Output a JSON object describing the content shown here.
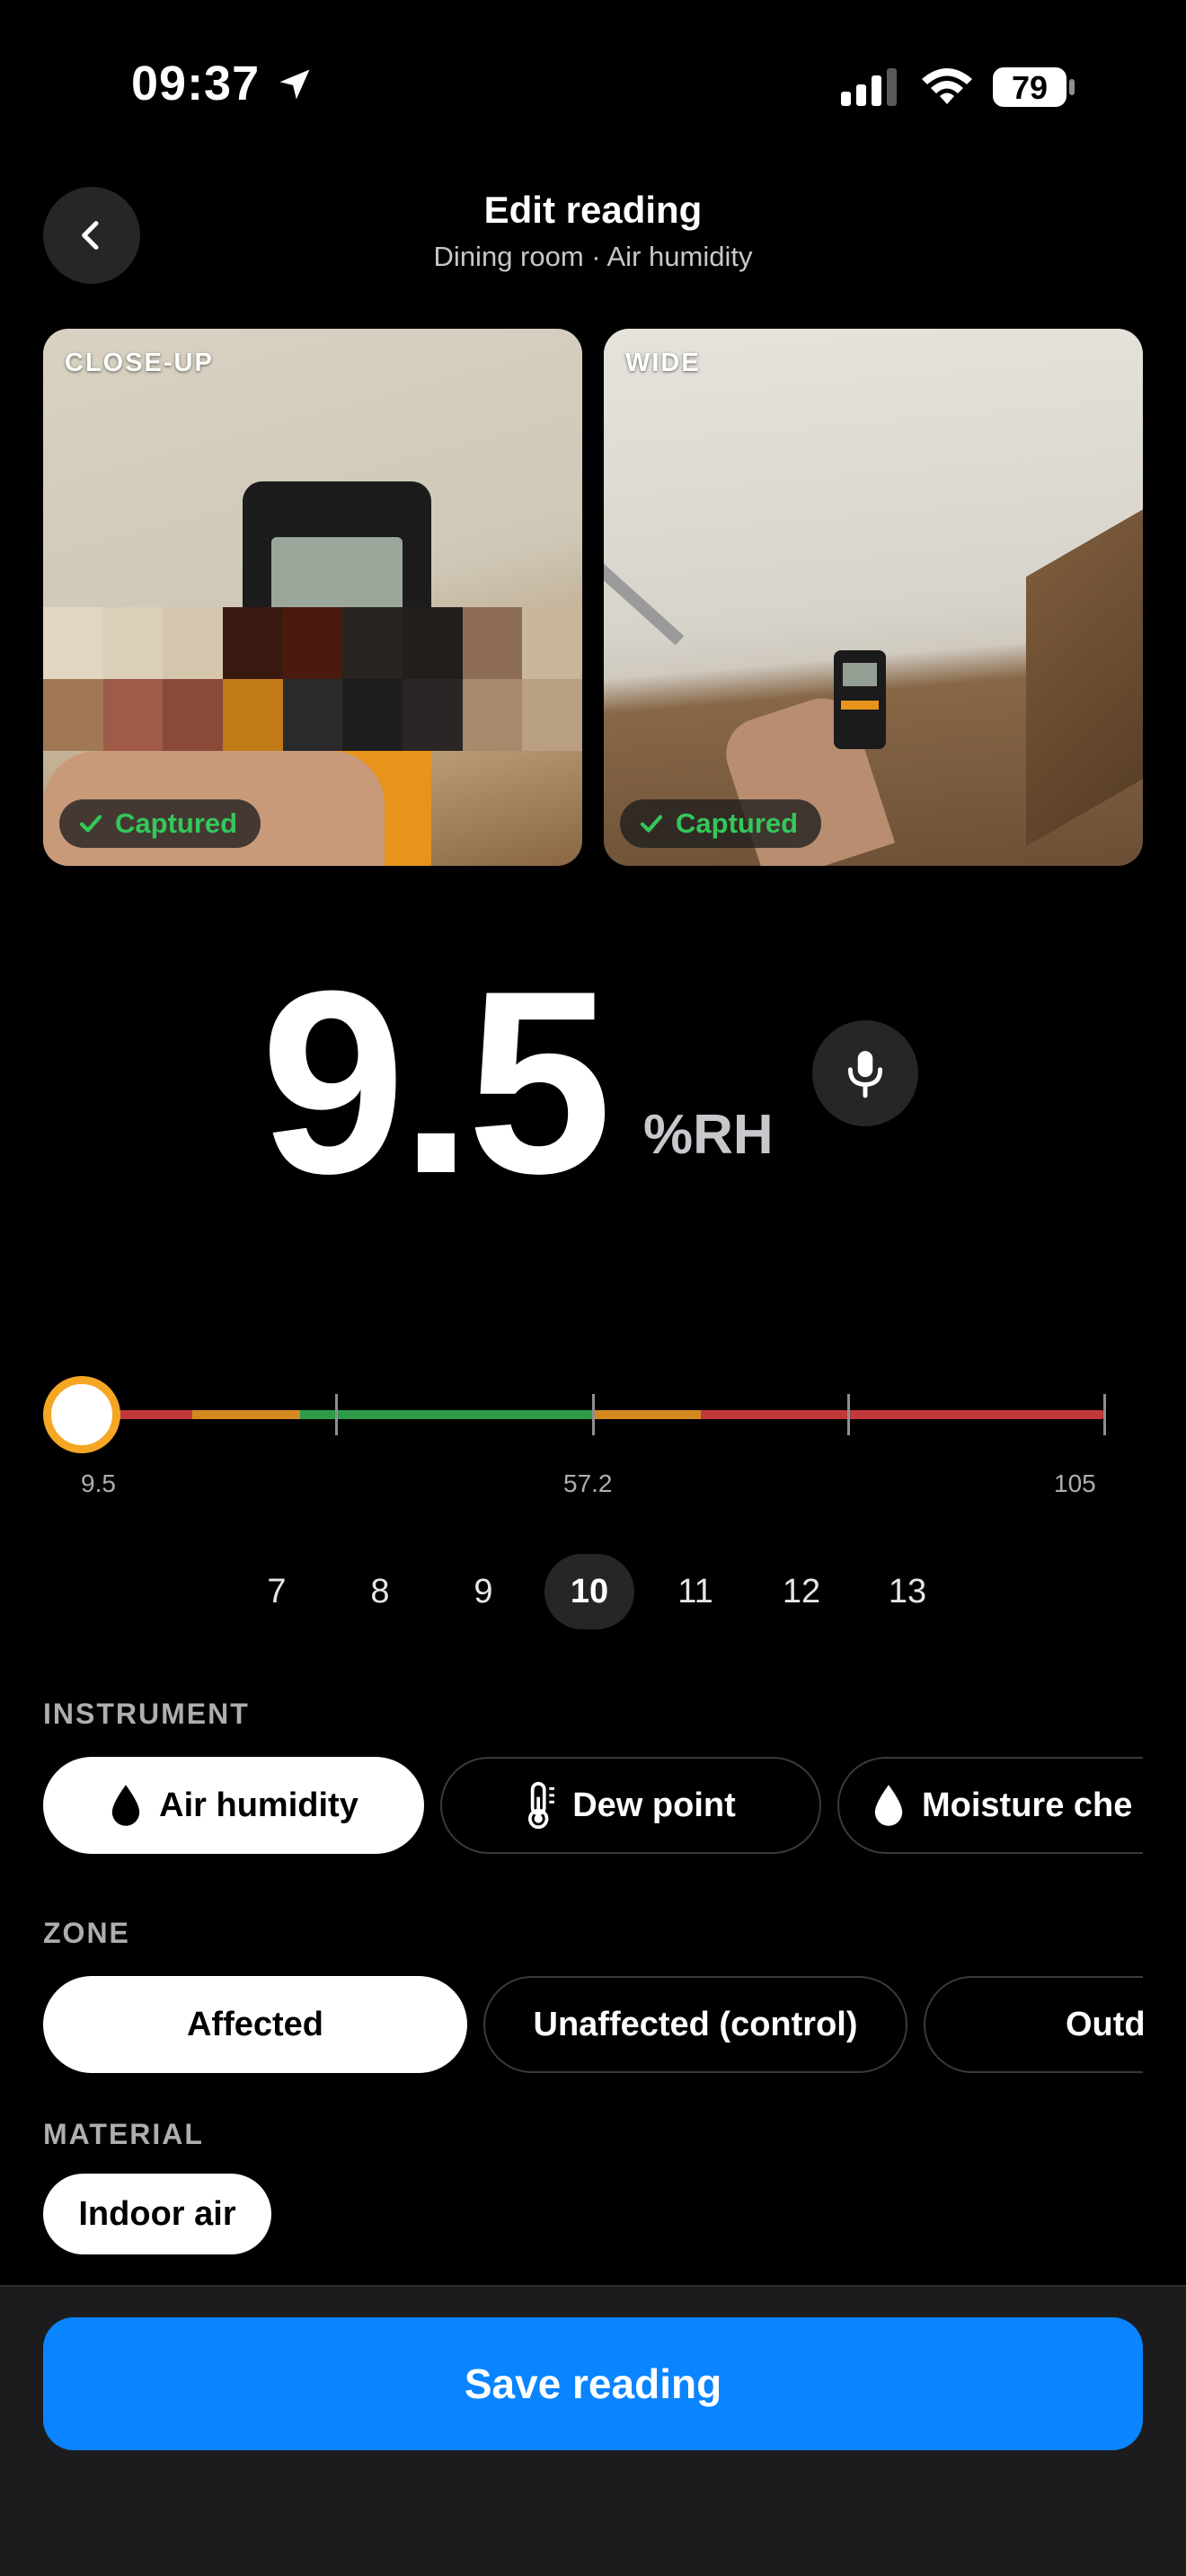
{
  "status_bar": {
    "time": "09:37",
    "battery": "79"
  },
  "header": {
    "title": "Edit reading",
    "subtitle": "Dining room · Air humidity"
  },
  "photos": [
    {
      "label": "CLOSE-UP",
      "status": "Captured"
    },
    {
      "label": "WIDE",
      "status": "Captured"
    }
  ],
  "reading": {
    "value": "9.5",
    "unit": "%RH"
  },
  "slider": {
    "value": 9.5,
    "min_label": "9.5",
    "mid_label": "57.2",
    "max_label": "105",
    "min": 9.5,
    "max": 105
  },
  "stepper": {
    "options": [
      "7",
      "8",
      "9",
      "10",
      "11",
      "12",
      "13"
    ],
    "selected": "10"
  },
  "instrument": {
    "label": "INSTRUMENT",
    "options": [
      "Air humidity",
      "Dew point",
      "Moisture che"
    ],
    "selected": "Air humidity"
  },
  "zone": {
    "label": "ZONE",
    "options": [
      "Affected",
      "Unaffected (control)",
      "Outd"
    ],
    "selected": "Affected"
  },
  "material": {
    "label": "MATERIAL",
    "options": [
      "Indoor air"
    ],
    "selected": "Indoor air"
  },
  "footer": {
    "save_label": "Save reading"
  },
  "colors": {
    "accent": "#0a84ff",
    "captured": "#34c759",
    "knob_ring": "#f5a623",
    "range_red": "#c0383c",
    "range_orange": "#d4891f",
    "range_green": "#2e9b4a"
  }
}
